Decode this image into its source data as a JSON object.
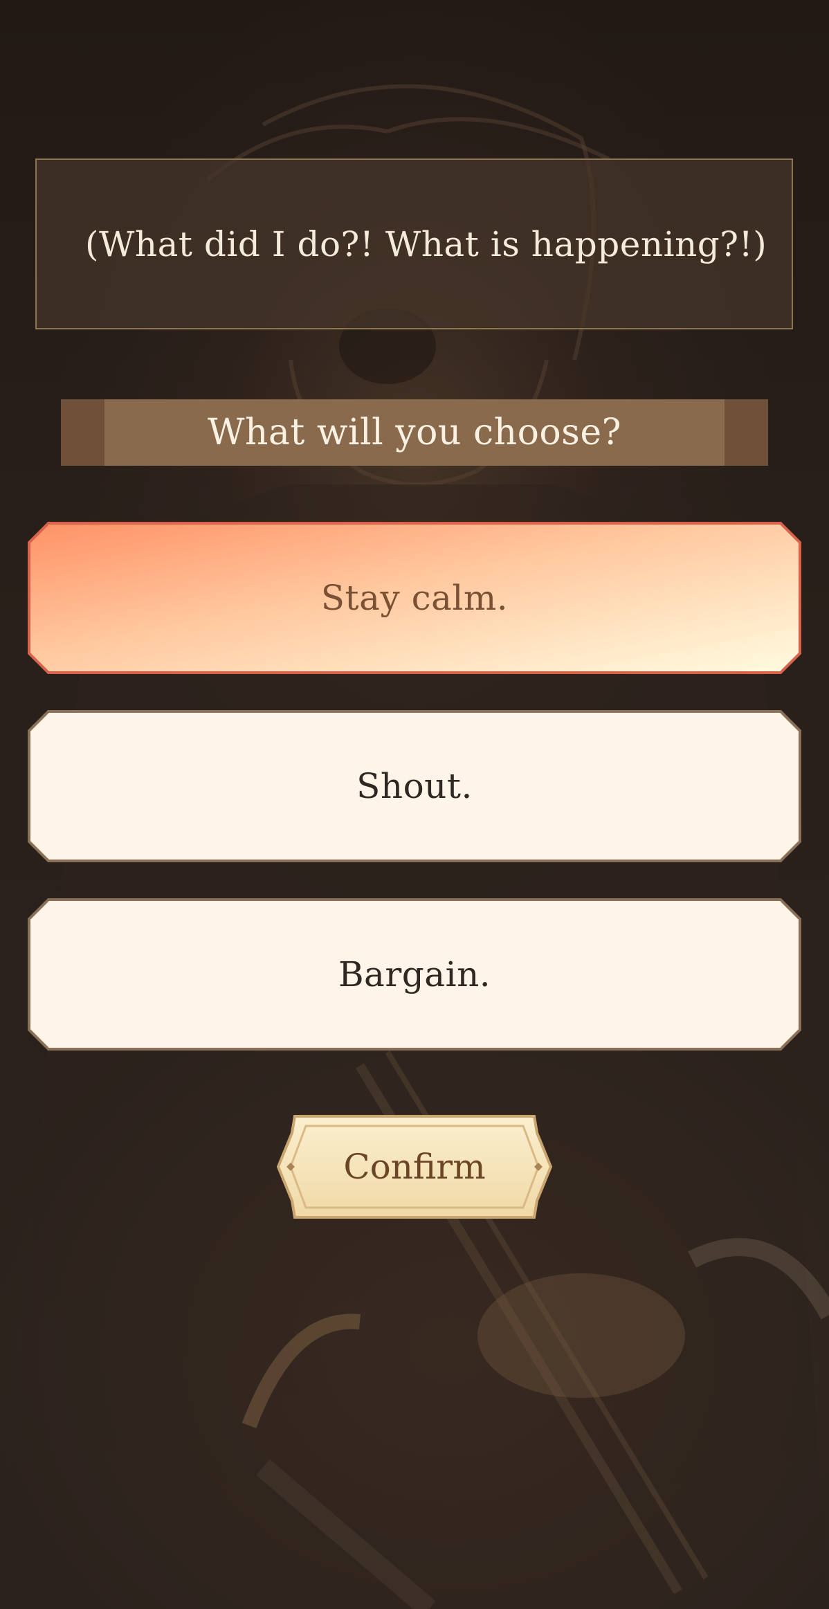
{
  "narration": {
    "text": "(What did I do?! What is happening?!)"
  },
  "prompt": {
    "text": "What will you choose?"
  },
  "choices": [
    {
      "label": "Stay calm.",
      "selected": true
    },
    {
      "label": "Shout.",
      "selected": false
    },
    {
      "label": "Bargain.",
      "selected": false
    }
  ],
  "confirm": {
    "label": "Confirm"
  },
  "colors": {
    "selected_border": "#d9634a",
    "selected_fill_start": "#ff9a70",
    "selected_fill_end": "#fff6dc",
    "option_border": "#8a7058",
    "option_fill": "#fff4e8",
    "panel_border": "#8c7552",
    "prompt_bar": "#8a6a4c"
  }
}
